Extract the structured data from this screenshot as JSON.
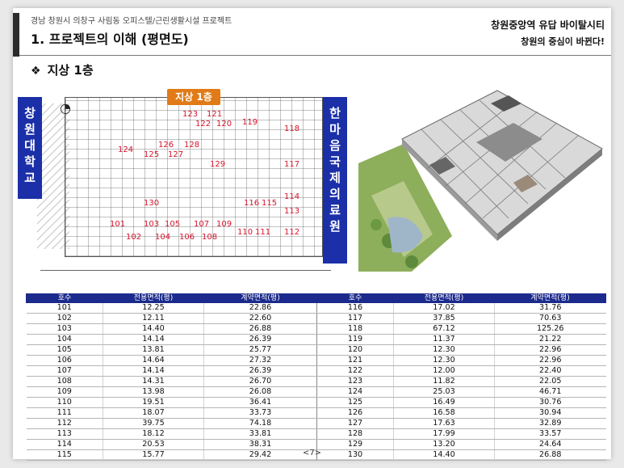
{
  "header": {
    "subtitle": "경남 창원시 의창구 사림동 오피스텔/근린생활시설 프로젝트",
    "title": "1. 프로젝트의 이해 (평면도)",
    "right_line1": "창원중앙역  유답 바이탈시티",
    "right_line2": "창원의 중심이 바뀐다!"
  },
  "section": {
    "bullet": "❖",
    "title": "지상 1층"
  },
  "plan": {
    "tag": "지상 1층",
    "left_label": [
      "창",
      "원",
      "대",
      "학",
      "교"
    ],
    "right_label": [
      "한",
      "마",
      "음",
      "국",
      "제",
      "의",
      "료",
      "원"
    ],
    "units": [
      "123",
      "121",
      "122",
      "120",
      "119",
      "118",
      "124",
      "126",
      "128",
      "125",
      "127",
      "129",
      "117",
      "130",
      "116",
      "115",
      "114",
      "113",
      "101",
      "103",
      "105",
      "107",
      "109",
      "102",
      "104",
      "106",
      "108",
      "110",
      "111",
      "112"
    ]
  },
  "table": {
    "headers": [
      "호수",
      "전용면적(평)",
      "계약면적(평)",
      "호수",
      "전용면적(평)",
      "계약면적(평)"
    ],
    "rows": [
      [
        "101",
        "12.25",
        "22.86",
        "116",
        "17.02",
        "31.76"
      ],
      [
        "102",
        "12.11",
        "22.60",
        "117",
        "37.85",
        "70.63"
      ],
      [
        "103",
        "14.40",
        "26.88",
        "118",
        "67.12",
        "125.26"
      ],
      [
        "104",
        "14.14",
        "26.39",
        "119",
        "11.37",
        "21.22"
      ],
      [
        "105",
        "13.81",
        "25.77",
        "120",
        "12.30",
        "22.96"
      ],
      [
        "106",
        "14.64",
        "27.32",
        "121",
        "12.30",
        "22.96"
      ],
      [
        "107",
        "14.14",
        "26.39",
        "122",
        "12.00",
        "22.40"
      ],
      [
        "108",
        "14.31",
        "26.70",
        "123",
        "11.82",
        "22.05"
      ],
      [
        "109",
        "13.98",
        "26.08",
        "124",
        "25.03",
        "46.71"
      ],
      [
        "110",
        "19.51",
        "36.41",
        "125",
        "16.49",
        "30.76"
      ],
      [
        "111",
        "18.07",
        "33.73",
        "126",
        "16.58",
        "30.94"
      ],
      [
        "112",
        "39.75",
        "74.18",
        "127",
        "17.63",
        "32.89"
      ],
      [
        "113",
        "18.12",
        "33.81",
        "128",
        "17.99",
        "33.57"
      ],
      [
        "114",
        "20.53",
        "38.31",
        "129",
        "13.20",
        "24.64"
      ],
      [
        "115",
        "15.77",
        "29.42",
        "130",
        "14.40",
        "26.88"
      ]
    ]
  },
  "footer": {
    "page": "<7>"
  }
}
